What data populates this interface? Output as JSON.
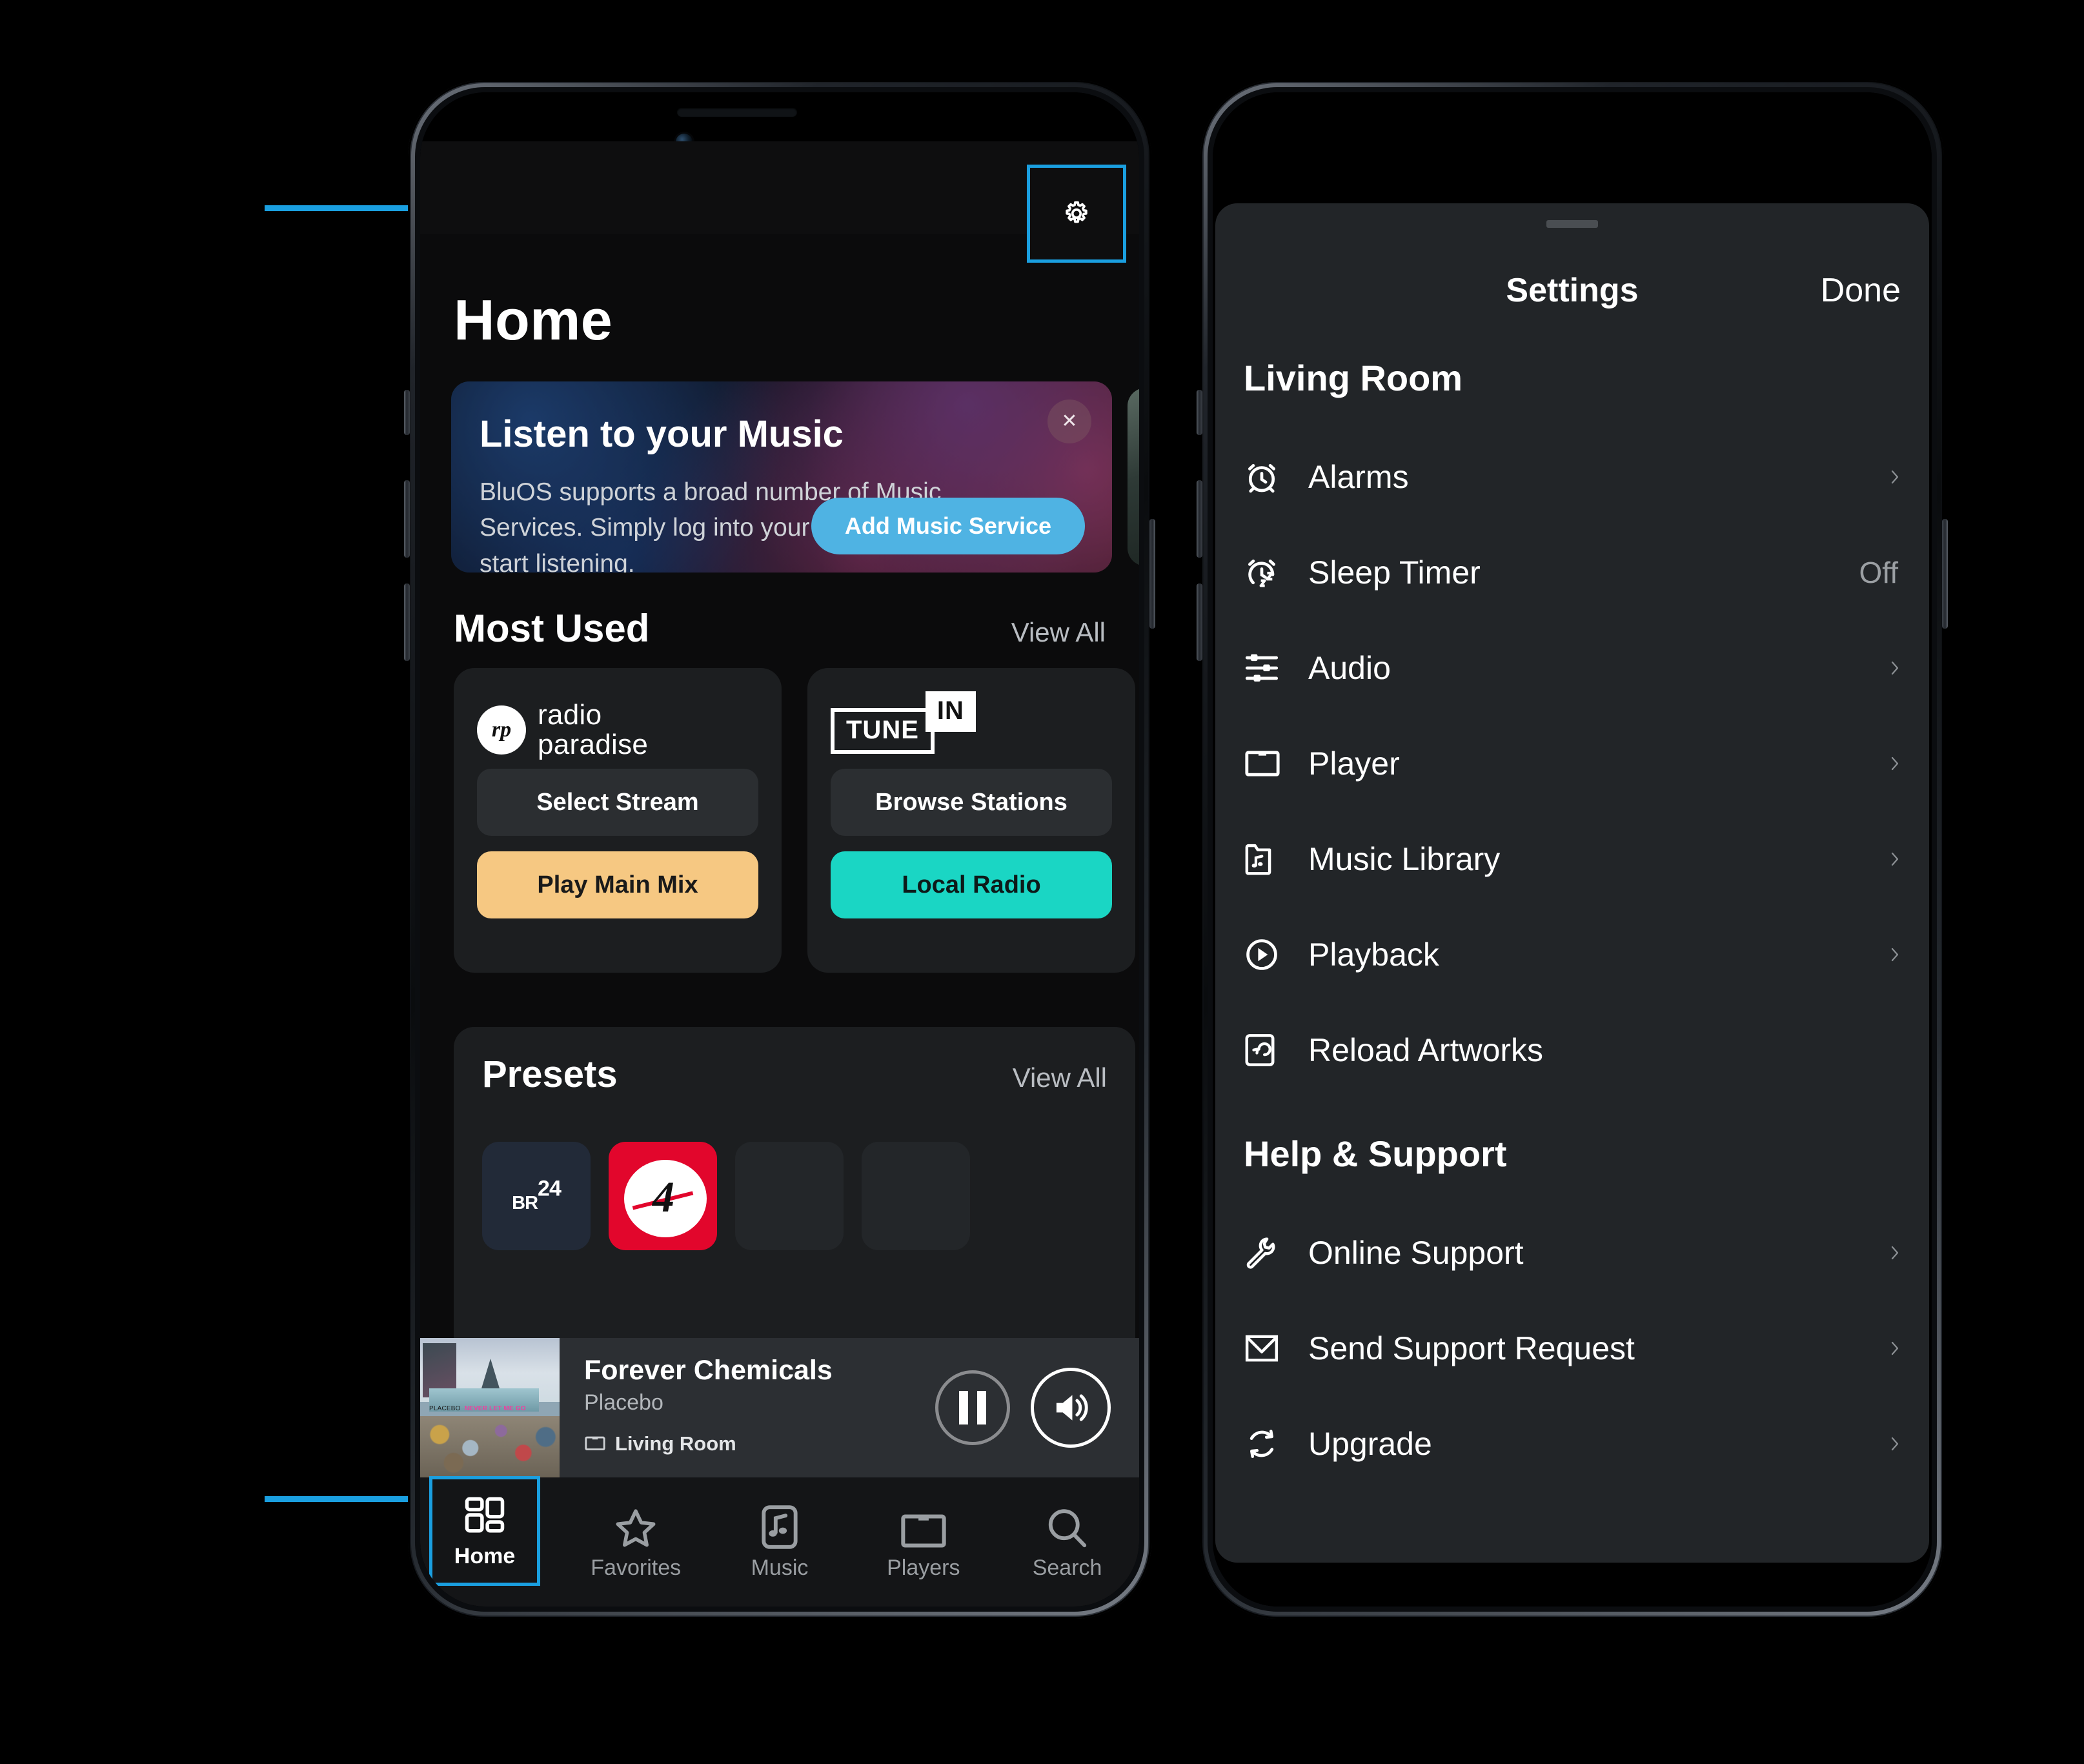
{
  "left_phone": {
    "topbar": {
      "settings_icon": "gear-icon"
    },
    "page_title": "Home",
    "promo": {
      "heading": "Listen to your Music",
      "body": "BluOS supports a broad number of Music Services. Simply log into your favorite and start listening.",
      "cta": "Add Music Service",
      "close_icon": "close-icon"
    },
    "most_used": {
      "title": "Most Used",
      "view_all": "View All",
      "cards": [
        {
          "brand_line1": "radio",
          "brand_line2": "paradise",
          "mark": "rp",
          "secondary_button": "Select Stream",
          "primary_button": "Play Main Mix",
          "primary_color": "#f6c882"
        },
        {
          "brand_line1": "TUNE",
          "brand_line2": "IN",
          "secondary_button": "Browse Stations",
          "primary_button": "Local Radio",
          "primary_color": "#1ad6c4"
        }
      ]
    },
    "presets": {
      "title": "Presets",
      "view_all": "View All",
      "tiles": [
        {
          "label": "BR",
          "sup": "24",
          "kind": "br24"
        },
        {
          "label": "",
          "kind": "red-logo"
        },
        {
          "label": "",
          "kind": "empty"
        },
        {
          "label": "",
          "kind": "empty"
        }
      ]
    },
    "now_playing": {
      "title": "Forever Chemicals",
      "artist": "Placebo",
      "room": "Living Room",
      "room_icon": "player-icon",
      "album_caption_artist": "PLACEBO",
      "album_caption_album": "NEVER LET ME GO",
      "pause_icon": "pause-icon",
      "volume_icon": "volume-icon"
    },
    "tabs": [
      {
        "label": "Home",
        "icon": "grid-icon",
        "active": true
      },
      {
        "label": "Favorites",
        "icon": "star-icon",
        "active": false
      },
      {
        "label": "Music",
        "icon": "music-note-icon",
        "active": false
      },
      {
        "label": "Players",
        "icon": "speaker-icon",
        "active": false
      },
      {
        "label": "Search",
        "icon": "search-icon",
        "active": false
      }
    ]
  },
  "right_phone": {
    "sheet_title": "Settings",
    "done_label": "Done",
    "groups": [
      {
        "title": "Living Room",
        "items": [
          {
            "label": "Alarms",
            "icon": "alarm-clock-icon",
            "value": "",
            "chevron": true
          },
          {
            "label": "Sleep Timer",
            "icon": "sleep-timer-icon",
            "value": "Off",
            "chevron": false
          },
          {
            "label": "Audio",
            "icon": "audio-sliders-icon",
            "value": "",
            "chevron": true
          },
          {
            "label": "Player",
            "icon": "speaker-icon",
            "value": "",
            "chevron": true
          },
          {
            "label": "Music Library",
            "icon": "music-folder-icon",
            "value": "",
            "chevron": true
          },
          {
            "label": "Playback",
            "icon": "play-circle-icon",
            "value": "",
            "chevron": true
          },
          {
            "label": "Reload Artworks",
            "icon": "reload-artwork-icon",
            "value": "",
            "chevron": false
          }
        ]
      },
      {
        "title": "Help & Support",
        "items": [
          {
            "label": "Online Support",
            "icon": "wrench-icon",
            "value": "",
            "chevron": true
          },
          {
            "label": "Send Support Request",
            "icon": "envelope-icon",
            "value": "",
            "chevron": true
          },
          {
            "label": "Upgrade",
            "icon": "refresh-cycle-icon",
            "value": "",
            "chevron": true
          }
        ]
      }
    ]
  },
  "annotations": {
    "accent_color": "#1a9fe0",
    "callout_top_target": "gear-icon",
    "callout_bottom_target": "home-tab"
  }
}
